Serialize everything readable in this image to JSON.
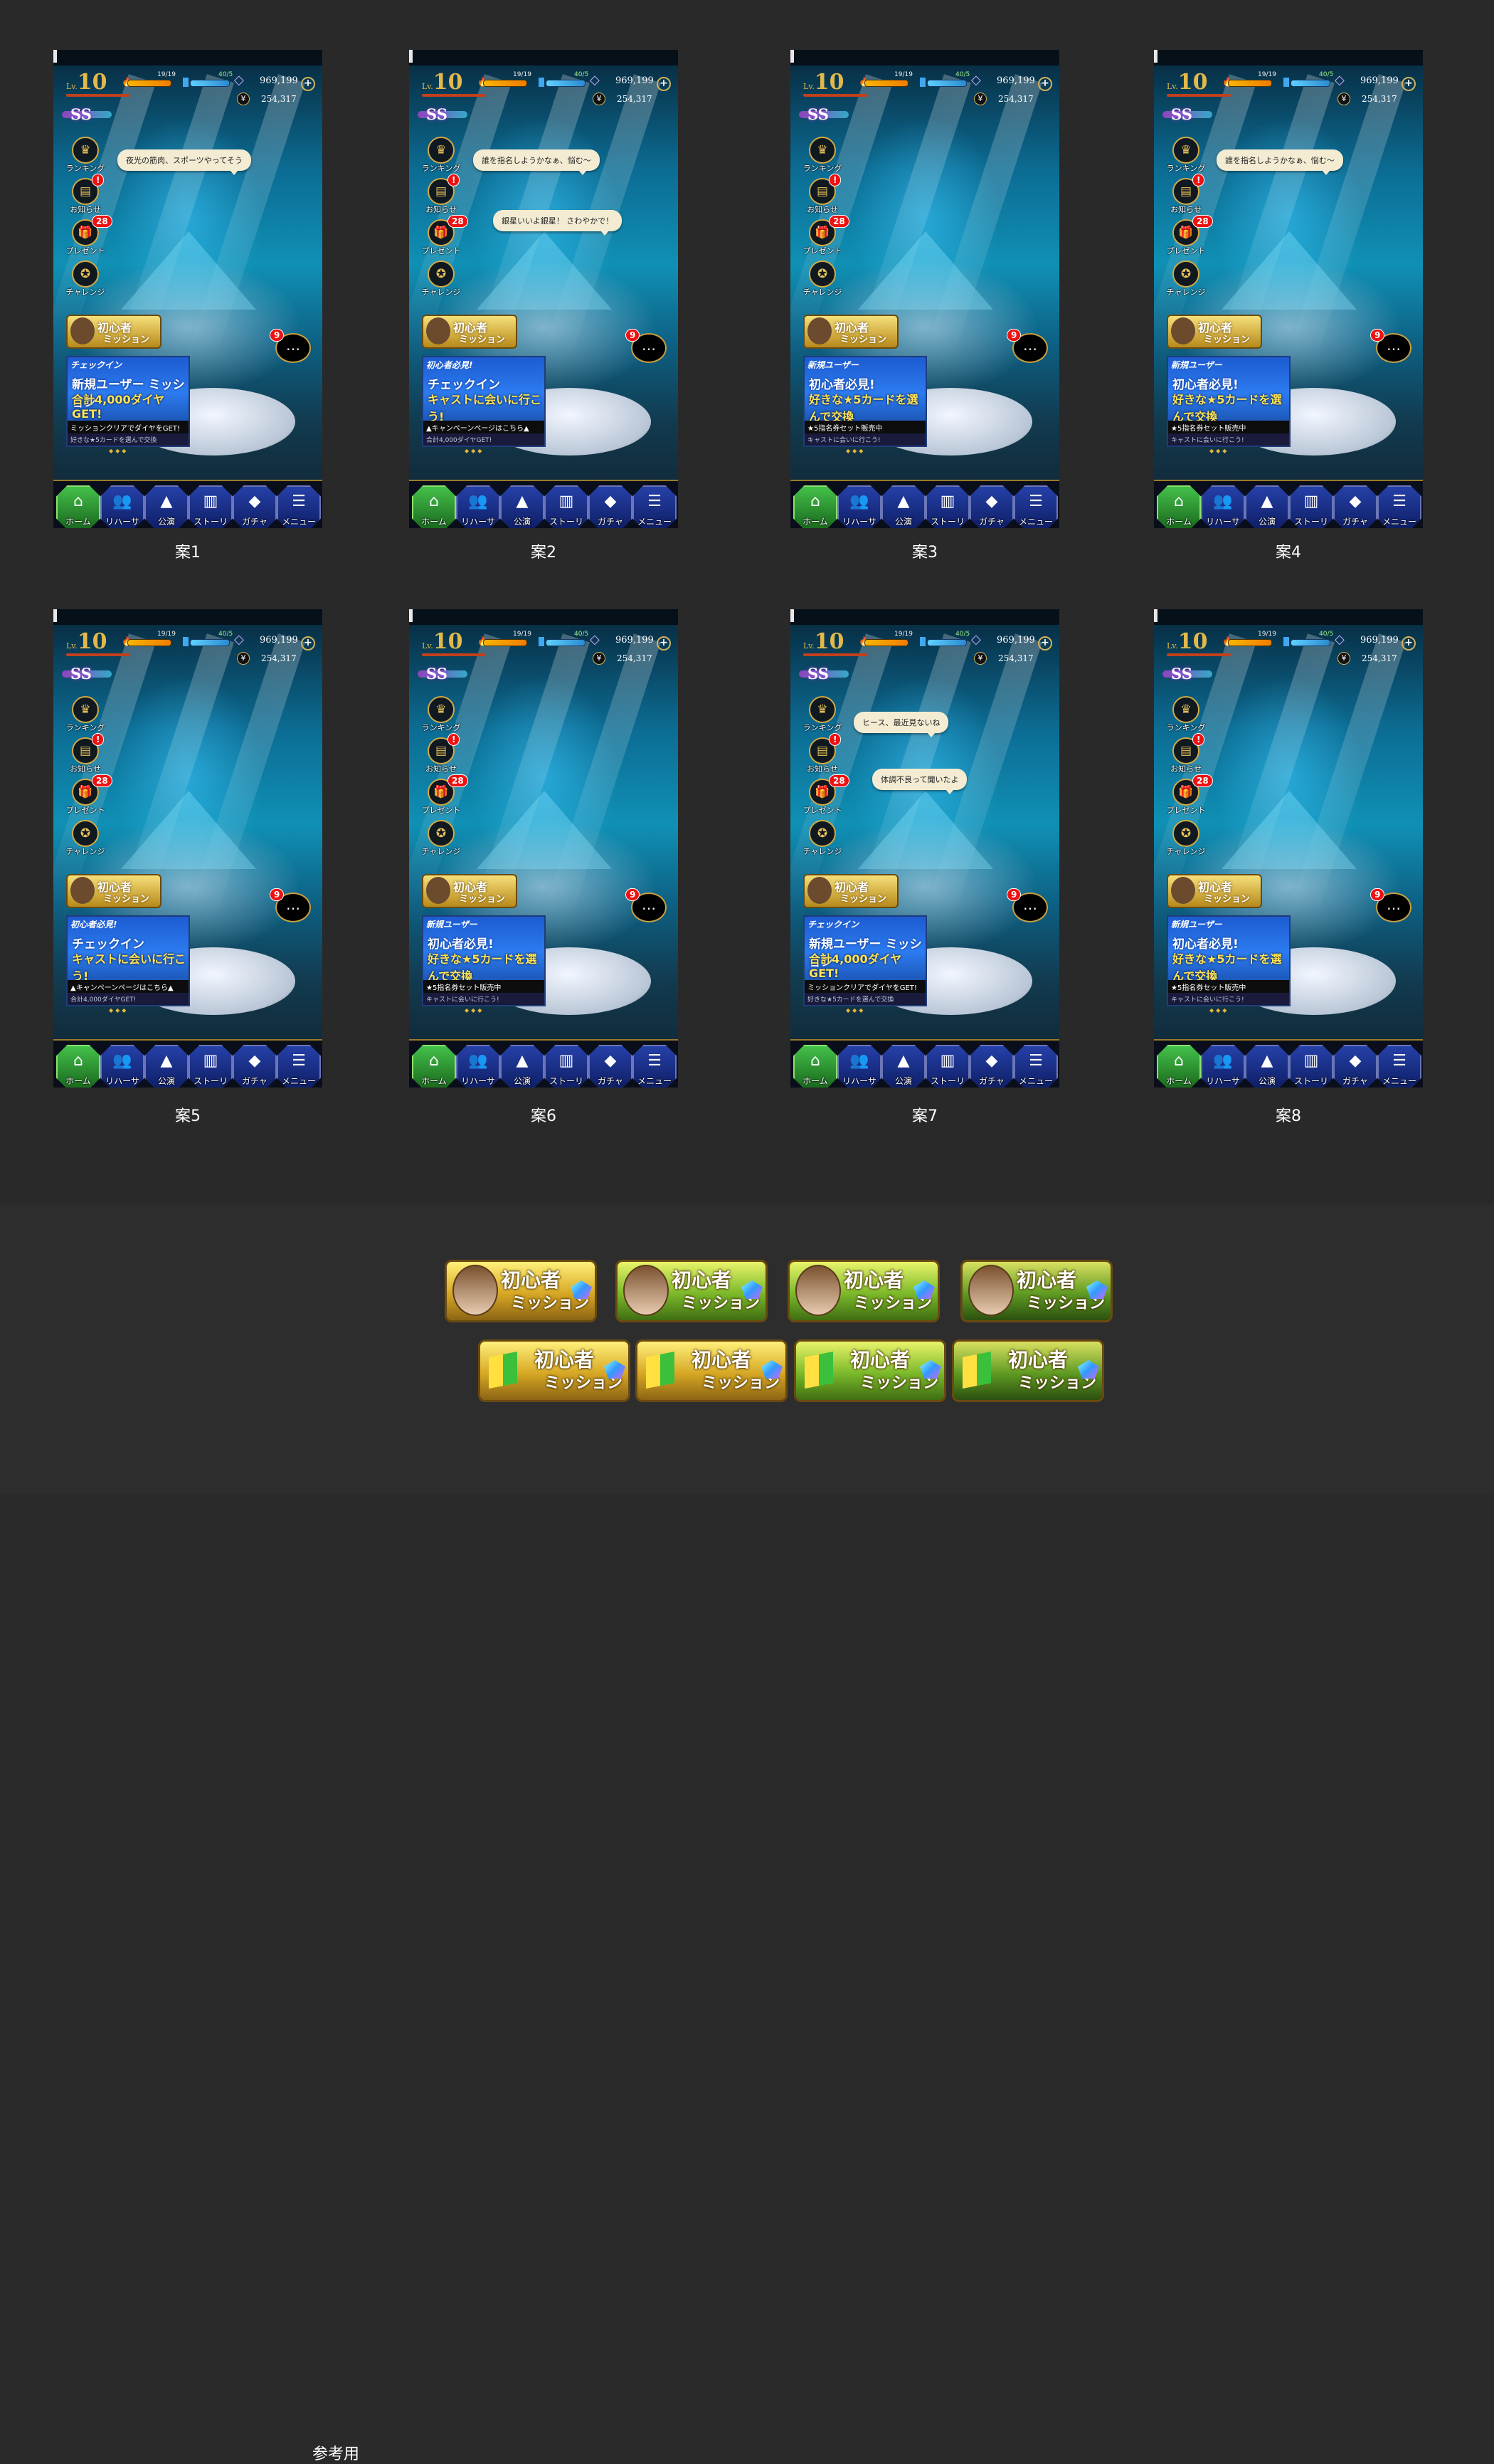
{
  "hud": {
    "lv_prefix": "Lv.",
    "level": "10",
    "stamina": "19/19",
    "bp": "40/5",
    "diamonds": "969,199",
    "yen_icon": "¥",
    "yen": "254,317",
    "rank": "SS"
  },
  "side_menu": [
    {
      "label": "ランキング",
      "icon": "crown-icon",
      "glyph": "♛",
      "badge": ""
    },
    {
      "label": "お知らせ",
      "icon": "notice-icon",
      "glyph": "▤",
      "badge": "!"
    },
    {
      "label": "プレゼント",
      "icon": "gift-icon",
      "glyph": "🎁",
      "badge": "28"
    },
    {
      "label": "チャレンジ",
      "icon": "medal-icon",
      "glyph": "✪",
      "badge": ""
    }
  ],
  "chat_badge": "9",
  "mission_badge": {
    "line1": "初心者",
    "line2": "ミッション"
  },
  "nav": [
    {
      "label": "ホーム",
      "icon": "home-icon",
      "glyph": "⌂"
    },
    {
      "label": "リハーサル",
      "icon": "rehearsal-icon",
      "glyph": "👥"
    },
    {
      "label": "公演",
      "icon": "stage-icon",
      "glyph": "▲"
    },
    {
      "label": "ストーリー",
      "icon": "book-icon",
      "glyph": "▥"
    },
    {
      "label": "ガチャ",
      "icon": "gem-icon",
      "glyph": "◆"
    },
    {
      "label": "メニュー",
      "icon": "menu-icon",
      "glyph": "☰"
    }
  ],
  "banners": {
    "mission": {
      "b1": "チェックイン",
      "b2": "新規ユーザー ミッション",
      "b3": "合計4,000ダイヤGET!",
      "b4": "ミッションクリアでダイヤをGET!",
      "b5": "好きな★5カードを選んで交換"
    },
    "checkin": {
      "b1": "初心者必見!",
      "b2": "チェックイン",
      "b3": "キャストに会いに行こう!",
      "b4": "▲キャンペーンページはこちら▲",
      "b5": "合計4,000ダイヤGET!"
    },
    "newuser": {
      "b1": "新規ユーザー",
      "b2": "初心者必見!",
      "b3": "好きな★5カードを選んで交換",
      "b4": "★5指名券セット販売中",
      "b5": "キャストに会いに行こう!"
    }
  },
  "mockups": [
    {
      "caption": "案1",
      "bubbles": [
        "夜光の筋肉、スポーツやってそう"
      ],
      "banner": "mission"
    },
    {
      "caption": "案2",
      "bubbles": [
        "誰を指名しようかなぁ、悩む〜",
        "銀星いいよ銀星！ さわやかで！"
      ],
      "banner": "checkin"
    },
    {
      "caption": "案3",
      "bubbles": [],
      "banner": "newuser"
    },
    {
      "caption": "案4",
      "bubbles": [
        "誰を指名しようかなぁ、悩む〜"
      ],
      "banner": "newuser"
    },
    {
      "caption": "案5",
      "bubbles": [],
      "banner": "checkin"
    },
    {
      "caption": "案6",
      "bubbles": [],
      "banner": "newuser"
    },
    {
      "caption": "案7",
      "bubbles": [
        "ヒース、最近見ないね",
        "体調不良って聞いたよ"
      ],
      "banner": "mission"
    },
    {
      "caption": "案8",
      "bubbles": [],
      "banner": "newuser"
    }
  ],
  "reference": {
    "title": "参考用",
    "badges": [
      {
        "line1": "初心者",
        "line2": "ミッション",
        "style": "gold-face"
      },
      {
        "line1": "初心者",
        "line2": "ミッション",
        "style": "green-face"
      },
      {
        "line1": "初心者",
        "line2": "ミッション",
        "style": "green-face"
      },
      {
        "line1": "初心者",
        "line2": "ミッション",
        "style": "dark-face"
      },
      {
        "line1": "初心者",
        "line2": "ミッション",
        "style": "gold-leaf"
      },
      {
        "line1": "初心者",
        "line2": "ミッション",
        "style": "gold-leaf"
      },
      {
        "line1": "初心者",
        "line2": "ミッション",
        "style": "green-leaf"
      },
      {
        "line1": "初心者",
        "line2": "ミッション",
        "style": "dark-leaf"
      }
    ]
  }
}
